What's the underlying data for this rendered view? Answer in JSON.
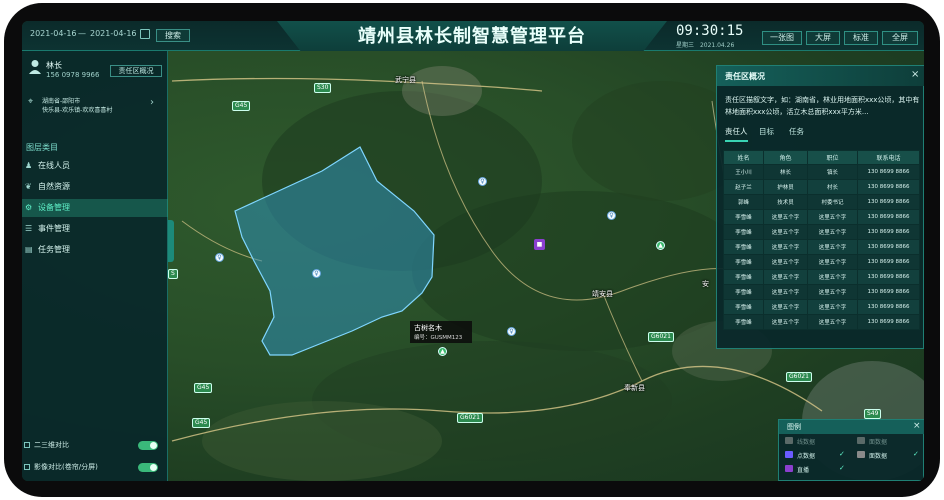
{
  "header": {
    "title": "靖州县林长制智慧管理平台",
    "date_start": "2021-04-16",
    "date_sep": "—",
    "date_end": "2021-04-16",
    "search_label": "搜索",
    "time": "09:30:15",
    "weekday": "星期三",
    "date_small": "2021.04.26",
    "buttons": [
      "一张图",
      "大屏",
      "标准",
      "全屏"
    ]
  },
  "user": {
    "name": "林长",
    "phone": "156 0978 9966",
    "area_button": "责任区概况",
    "location_line1": "湖南省-邵阳市",
    "location_line2": "快乐县-欢乐镇-欢欢喜喜村"
  },
  "sidebar": {
    "category_title": "图层类目",
    "items": [
      {
        "label": "在线人员",
        "icon": "person-icon",
        "active": false
      },
      {
        "label": "自然资源",
        "icon": "leaf-icon",
        "active": false
      },
      {
        "label": "设备管理",
        "icon": "gear-icon",
        "active": true
      },
      {
        "label": "事件管理",
        "icon": "list-icon",
        "active": false
      },
      {
        "label": "任务管理",
        "icon": "document-icon",
        "active": false
      }
    ],
    "toggles": [
      {
        "label": "二三维对比"
      },
      {
        "label": "影像对比(卷帘/分屏)"
      }
    ]
  },
  "panel": {
    "title": "责任区概况",
    "description": "责任区描叙文字，如：湖南省，林业用地面积xxx公顷，其中有林地面积xxx公顷，活立木总面积xxx平方米...",
    "tabs": [
      "责任人",
      "目标",
      "任务"
    ],
    "table": {
      "headers": [
        "姓名",
        "角色",
        "职位",
        "联系电话"
      ],
      "rows": [
        [
          "王小川",
          "林长",
          "镇长",
          "130 8699 8866"
        ],
        [
          "赵子兰",
          "护林员",
          "村长",
          "130 8699 8866"
        ],
        [
          "郭峰",
          "技术员",
          "村委书记",
          "130 8699 8866"
        ],
        [
          "李雪峰",
          "这里五个字",
          "这里五个字",
          "130 8699 8866"
        ],
        [
          "李雪峰",
          "这里五个字",
          "这里五个字",
          "130 8699 8866"
        ],
        [
          "李雪峰",
          "这里五个字",
          "这里五个字",
          "130 8699 8866"
        ],
        [
          "李雪峰",
          "这里五个字",
          "这里五个字",
          "130 8699 8866"
        ],
        [
          "李雪峰",
          "这里五个字",
          "这里五个字",
          "130 8699 8866"
        ],
        [
          "李雪峰",
          "这里五个字",
          "这里五个字",
          "130 8699 8866"
        ],
        [
          "李雪峰",
          "这里五个字",
          "这里五个字",
          "130 8699 8866"
        ],
        [
          "李雪峰",
          "这里五个字",
          "这里五个字",
          "130 8699 8866"
        ]
      ]
    }
  },
  "legend": {
    "title": "图例",
    "items": [
      {
        "label": "线数据",
        "enabled": false
      },
      {
        "label": "面数据",
        "enabled": false
      },
      {
        "label": "点数据",
        "enabled": true,
        "color": "#6b5cff"
      },
      {
        "label": "面数据",
        "enabled": true,
        "color": "#8a8a8a"
      },
      {
        "label": "直播",
        "enabled": true,
        "color": "#8b3fcf"
      }
    ]
  },
  "map": {
    "places": [
      "武宁县",
      "靖安县",
      "奉新县",
      "安"
    ],
    "roads": [
      "S30",
      "G45",
      "G45",
      "G6021",
      "G6021",
      "G6021",
      "G45",
      "S49",
      "S"
    ],
    "tooltip": {
      "title": "古树名木",
      "code": "编号：GUSMM123"
    }
  },
  "colors": {
    "accent": "#2bd3b0",
    "panel": "#0a2a2c",
    "region": "#2f8fb6"
  }
}
